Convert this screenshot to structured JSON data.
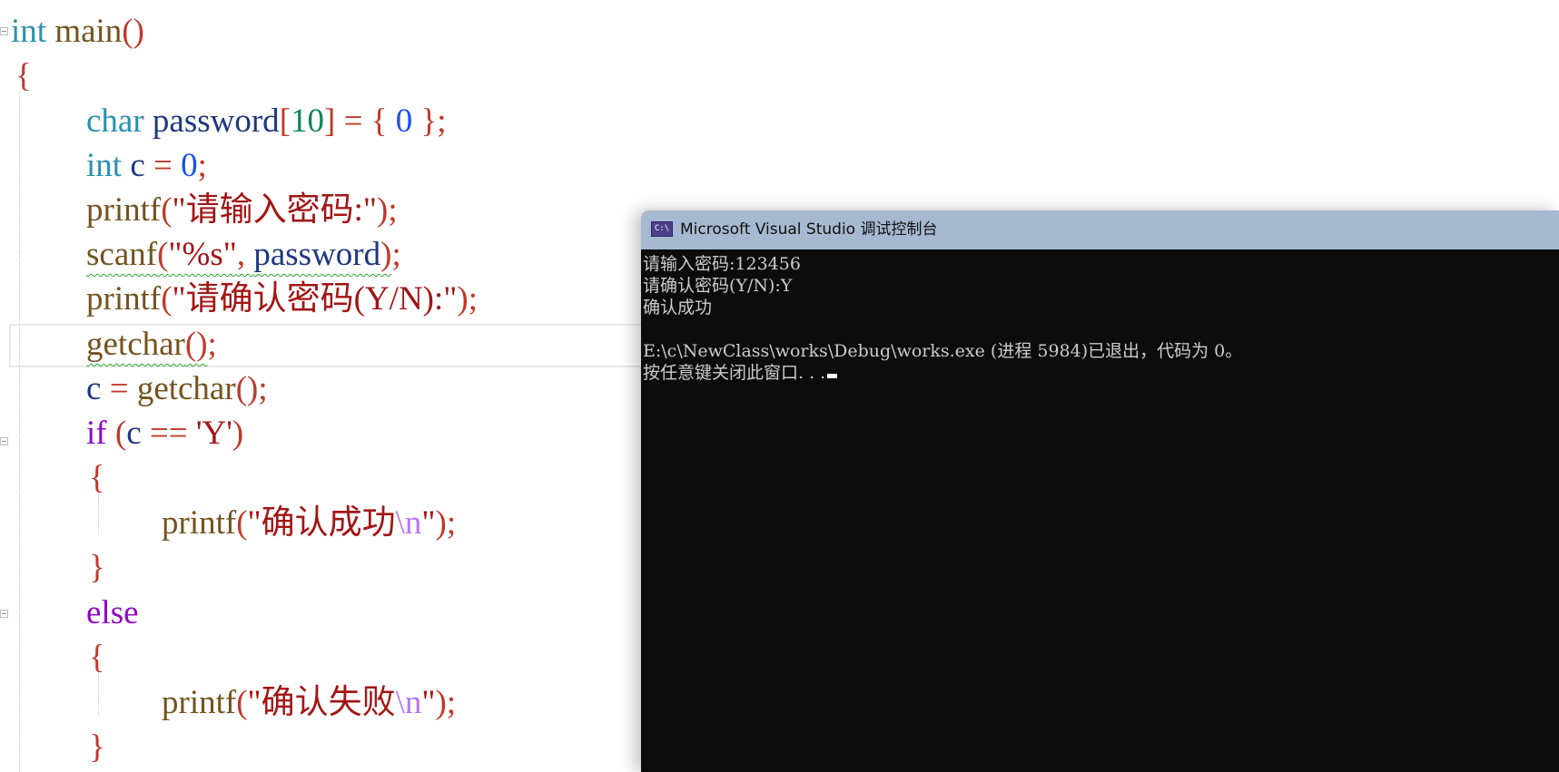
{
  "editor": {
    "lines": {
      "l1": {
        "kw": "int",
        "fn": "main",
        "paren": "()"
      },
      "l2": {
        "brace": "{"
      },
      "l3": {
        "type": "char",
        "var": "password",
        "lb": "[",
        "num": "10",
        "rb": "]",
        "eq": " = ",
        "ob": "{",
        "zero": " 0 ",
        "cb": "}",
        "semi": ";"
      },
      "l4": {
        "type": "int",
        "var": "c",
        "eq": " = ",
        "num": "0",
        "semi": ";"
      },
      "l5": {
        "fn": "printf",
        "open": "(",
        "str": "\"请输入密码:\"",
        "close": ")",
        "semi": ";"
      },
      "l6": {
        "fn": "scanf",
        "open": "(",
        "str": "\"%s\"",
        "comma": ", ",
        "var": "password",
        "close": ")",
        "semi": ";"
      },
      "l7": {
        "fn": "printf",
        "open": "(",
        "str": "\"请确认密码(Y/N):\"",
        "close": ")",
        "semi": ";"
      },
      "l8": {
        "fn": "getchar",
        "paren": "()",
        "semi": ";"
      },
      "l9": {
        "var": "c",
        "eq": " = ",
        "fn": "getchar",
        "paren": "()",
        "semi": ";"
      },
      "l10": {
        "kw": "if",
        "open": " (",
        "var": "c",
        "eq": " == ",
        "chr": "'Y'",
        "close": ")"
      },
      "l11": {
        "brace": "{"
      },
      "l12": {
        "fn": "printf",
        "open": "(",
        "str1": "\"确认成功",
        "esc": "\\n",
        "str2": "\"",
        "close": ")",
        "semi": ";"
      },
      "l13": {
        "brace": "}"
      },
      "l14": {
        "kw": "else"
      },
      "l15": {
        "brace": "{"
      },
      "l16": {
        "fn": "printf",
        "open": "(",
        "str1": "\"确认失败",
        "esc": "\\n",
        "str2": "\"",
        "close": ")",
        "semi": ";"
      },
      "l17": {
        "brace": "}"
      }
    }
  },
  "console": {
    "title": "Microsoft Visual Studio 调试控制台",
    "icon_text": "C:\\",
    "icon": "console-app-icon",
    "lines": [
      "请输入密码:123456",
      "请确认密码(Y/N):Y",
      "确认成功",
      "",
      "E:\\c\\NewClass\\works\\Debug\\works.exe (进程 5984)已退出，代码为 0。",
      "按任意键关闭此窗口. . ."
    ]
  },
  "colors": {
    "keyword_type": "#2b91af",
    "keyword_control": "#8f08c4",
    "function": "#74531f",
    "variable": "#1f377f",
    "string": "#a31515",
    "console_bg": "#0c0c0c",
    "console_titlebar": "#a6b9d0"
  }
}
